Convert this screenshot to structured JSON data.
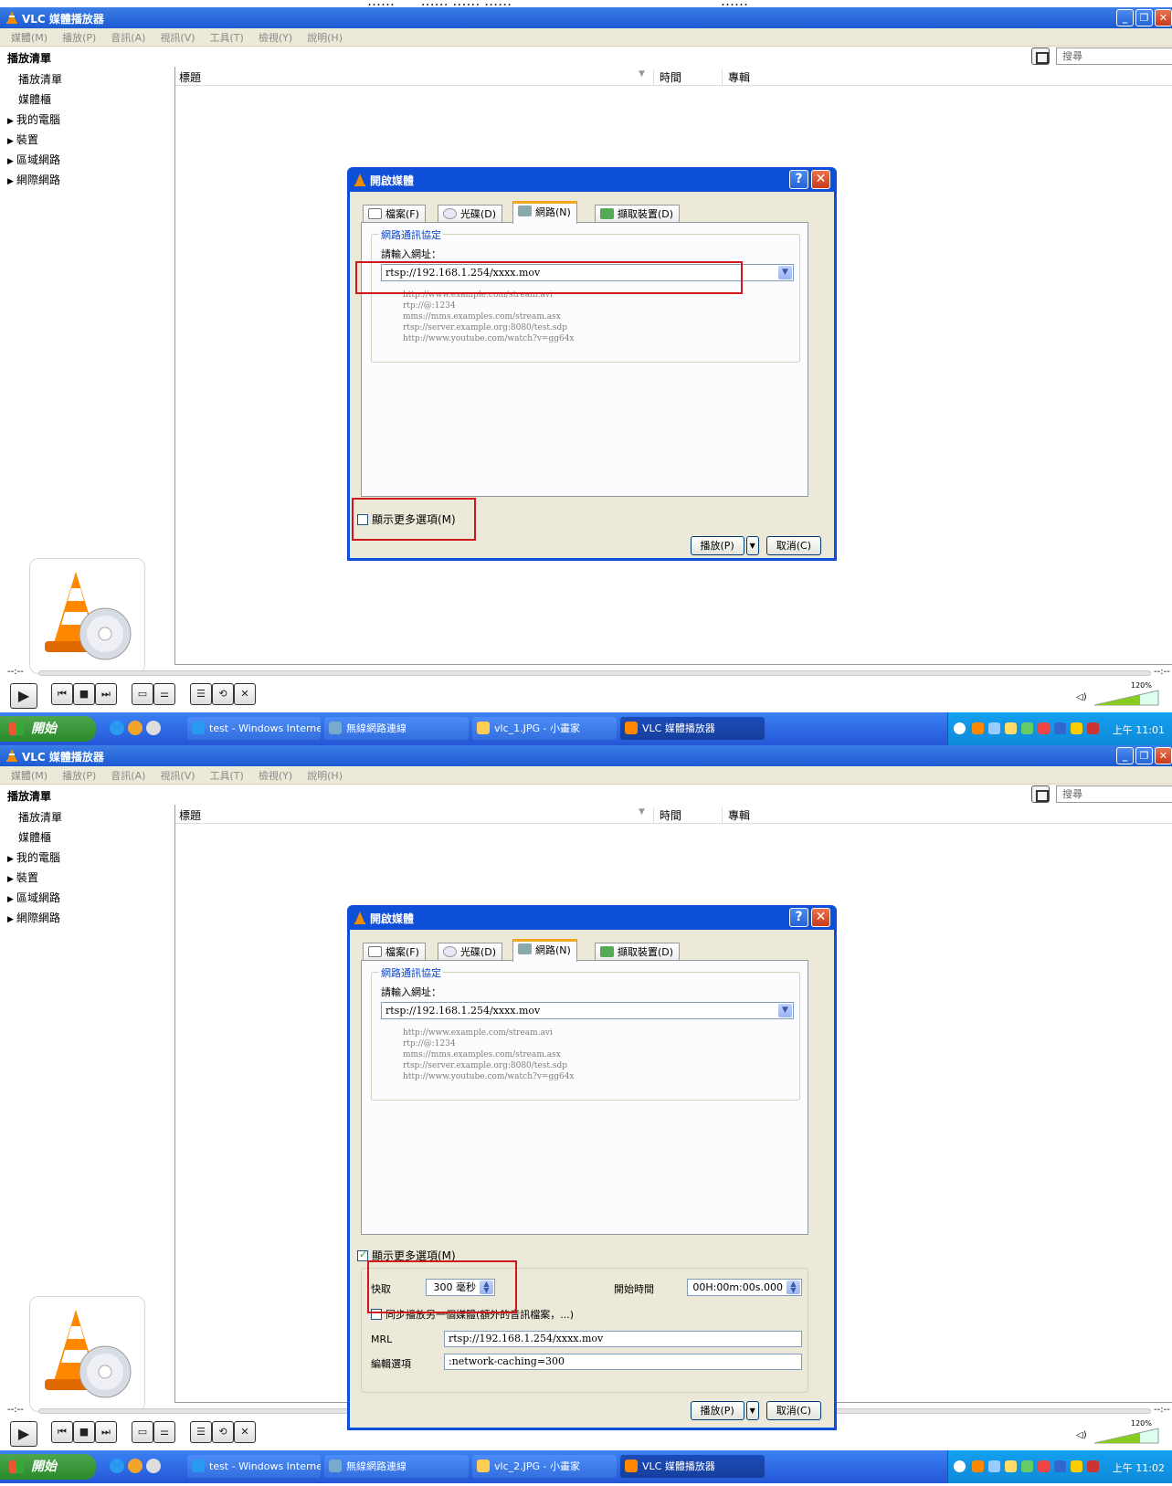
{
  "header_caption": "……      …… …… ……                                                ……",
  "window": {
    "title": "VLC 媒體播放器",
    "buttons": [
      "_",
      "❐",
      "✕"
    ]
  },
  "menu": [
    "媒體(M)",
    "播放(P)",
    "音訊(A)",
    "視訊(V)",
    "工具(T)",
    "檢視(Y)",
    "說明(H)"
  ],
  "playlist": {
    "heading": "播放清單",
    "search_placeholder": "搜尋",
    "sidebar": [
      {
        "label": "播放清單",
        "expandable": false
      },
      {
        "label": "媒體櫃",
        "expandable": false
      },
      {
        "label": "我的電腦",
        "expandable": true
      },
      {
        "label": "裝置",
        "expandable": true
      },
      {
        "label": "區域網路",
        "expandable": true
      },
      {
        "label": "網際網路",
        "expandable": true
      }
    ],
    "columns": {
      "title": "標題",
      "time": "時間",
      "album": "專輯"
    }
  },
  "seek": {
    "elapsed": "--:--",
    "remaining": "--:--"
  },
  "volume": {
    "percent": "120%"
  },
  "controls": {
    "play": "▶",
    "prev": "⏮",
    "stop": "■",
    "next": "⏭",
    "frame": "▭",
    "eq": "⚌",
    "playlist": "☰",
    "loop": "⟲",
    "random": "✕"
  },
  "dialog": {
    "title": "開啟媒體",
    "tabs": [
      "檔案(F)",
      "光碟(D)",
      "網路(N)",
      "擷取裝置(D)"
    ],
    "selected_tab": "網路(N)",
    "group_label": "網路通訊協定",
    "url_prompt": "請輸入網址：",
    "url_value_1": "rtsp://192.168.1.254/xxxx.mov",
    "url_value_2": "rtsp://192.168.1.254/xxxx.mov",
    "examples": [
      "http://www.example.com/stream.avi",
      "rtp://@:1234",
      "mms://mms.examples.com/stream.asx",
      "rtsp://server.example.org:8080/test.sdp",
      "http://www.youtube.com/watch?v=gg64x"
    ],
    "show_more": "顯示更多選項(M)",
    "play_button": "播放(P)",
    "cancel_button": "取消(C)",
    "advanced": {
      "caching_label": "快取",
      "caching_value": "300 毫秒",
      "start_time_label": "開始時間",
      "start_time_value": "00H:00m:00s.000",
      "sync_label": "同步播放另一個媒體(額外的音訊檔案，...)",
      "mrl_label": "MRL",
      "mrl_value": "rtsp://192.168.1.254/xxxx.mov",
      "edit_label": "編輯選項",
      "edit_value": ":network-caching=300"
    }
  },
  "taskbar": {
    "start": "開始",
    "tasks": [
      "test - Windows Interne...",
      "無線網路連線",
      "vlc_1.JPG - 小畫家",
      "VLC 媒體播放器"
    ],
    "tasks_2": [
      "test - Windows Interne...",
      "無線網路連線",
      "vlc_2.JPG - 小畫家",
      "VLC 媒體播放器"
    ],
    "clock_1": "上午 11:01",
    "clock_2": "上午 11:02"
  },
  "colors": {
    "titlebar": "#1c5ad2",
    "dialog_frame": "#0e4fd8",
    "highlight": "#d0181c",
    "tab_accent": "#f5a623"
  }
}
